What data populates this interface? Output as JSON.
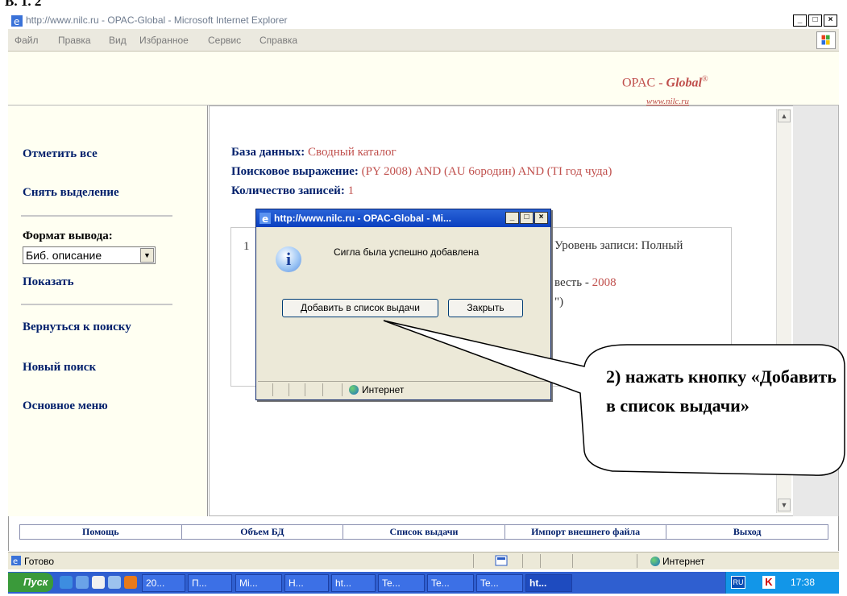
{
  "slide_heading": "В. 1. 2",
  "window": {
    "title": "http://www.nilc.ru - OPAC-Global - Microsoft Internet Explorer",
    "controls": [
      "_",
      "□",
      "×"
    ]
  },
  "menu": [
    "Файл",
    "Правка",
    "Вид",
    "Избранное",
    "Сервис",
    "Справка"
  ],
  "header": {
    "brand_prefix": "OPAC -",
    "brand_name": "Global",
    "brand_mark": "®",
    "brand_url": "www.nilc.ru"
  },
  "sidebar": {
    "select_all": "Отметить все",
    "deselect": "Снять выделение",
    "format_label": "Формат вывода:",
    "format_value": "Биб. описание",
    "show": "Показать",
    "back_to_search": "Вернуться к поиску",
    "new_search": "Новый поиск",
    "main_menu": "Основное меню"
  },
  "query": {
    "db_label": "База данных:",
    "db_value": "Сводный каталог",
    "expr_label": "Поисковое выражение:",
    "expr_value": "(PY 2008) AND (AU 6ородин) AND (TI год чуда)",
    "count_label": "Количество записей:",
    "count_value": "1"
  },
  "record": {
    "number": "1",
    "level": "Уровень записи: Полный",
    "line2_text": "весть - ",
    "line2_year": "2008",
    "line3": "\")"
  },
  "footer": [
    "Помощь",
    "Объем БД",
    "Список выдачи",
    "Импорт внешнего файла",
    "Выход"
  ],
  "status": {
    "text": "Готово",
    "zone": "Интернет"
  },
  "taskbar": {
    "start": "Пуск",
    "items": [
      "20...",
      "П...",
      "Mi...",
      "H...",
      "ht...",
      "Te...",
      "Te...",
      "Te...",
      "ht..."
    ],
    "lang": "RU",
    "clock": "17:38"
  },
  "dialog": {
    "title": "http://www.nilc.ru - OPAC-Global - Mi...",
    "message": "Сигла была успешно добавлена",
    "add_button": "Добавить в список выдачи",
    "close_button": "Закрыть",
    "zone": "Интернет"
  },
  "callout": {
    "text": "2) нажать кнопку «Добавить в список выдачи»"
  }
}
